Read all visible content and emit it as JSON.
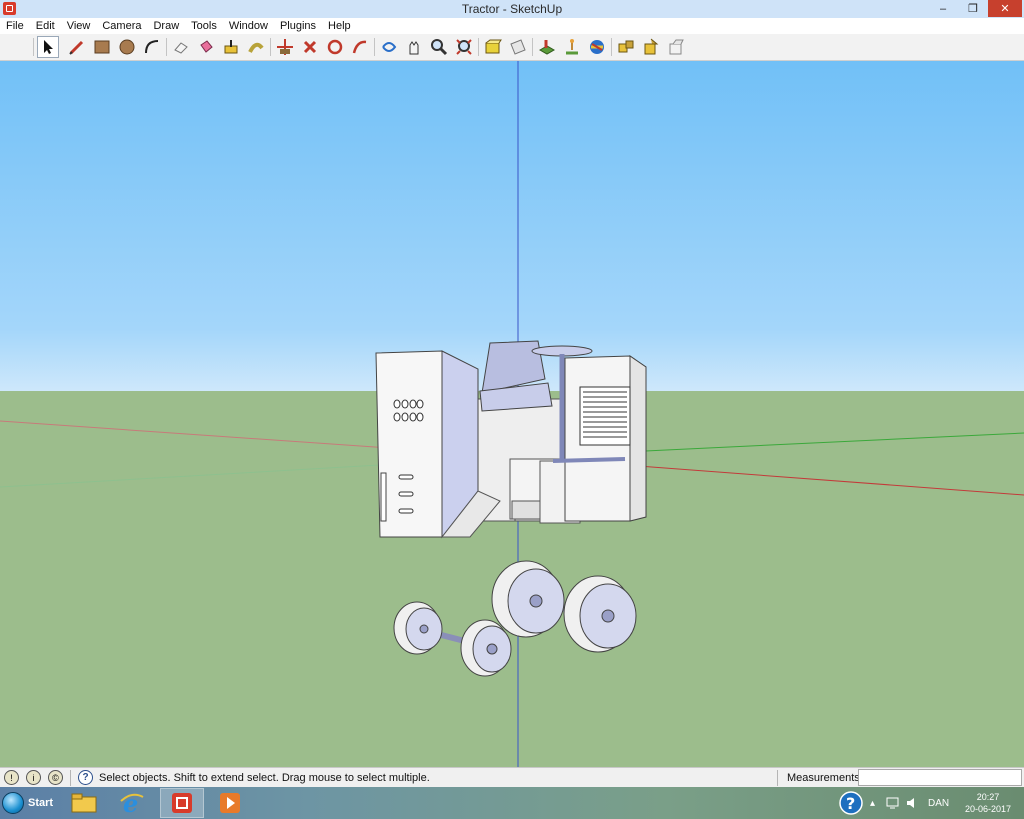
{
  "window": {
    "title": "Tractor - SketchUp",
    "controls": {
      "minimize": "‒",
      "restore": "❐",
      "close": "✕"
    }
  },
  "menu": [
    "File",
    "Edit",
    "View",
    "Camera",
    "Draw",
    "Tools",
    "Window",
    "Plugins",
    "Help"
  ],
  "toolbar": {
    "tools": [
      "select-icon",
      "pencil-icon",
      "rectangle-icon",
      "circle-icon",
      "arc-icon",
      "eraser-icon",
      "paint-bucket-icon",
      "push-pull-icon",
      "follow-me-icon",
      "move-icon",
      "rotate-icon",
      "scale-icon",
      "offset-icon",
      "orbit-icon",
      "pan-icon",
      "zoom-icon",
      "zoom-extents-icon",
      "components-icon",
      "section-plane-icon",
      "add-location-icon",
      "photo-textures-icon",
      "street-view-icon",
      "get-models-icon",
      "share-model-icon",
      "share-component-icon"
    ],
    "active": "select-icon"
  },
  "scene": {
    "sky_color": "#71c0f7",
    "ground_color": "#9cbd8c",
    "axis_colors": {
      "red": "#c33a3a",
      "green": "#3aa83a",
      "blue": "#3a55c8"
    }
  },
  "status": {
    "message": "Select objects. Shift to extend select. Drag mouse to select multiple.",
    "measurements_label": "Measurements",
    "measurements_value": ""
  },
  "taskbar": {
    "start_label": "Start",
    "apps": [
      "file-explorer-icon",
      "internet-explorer-icon",
      "sketchup-icon",
      "media-player-icon"
    ],
    "active_app": "sketchup-icon",
    "language": "DAN",
    "time": "20:27",
    "date": "20-06-2017"
  }
}
